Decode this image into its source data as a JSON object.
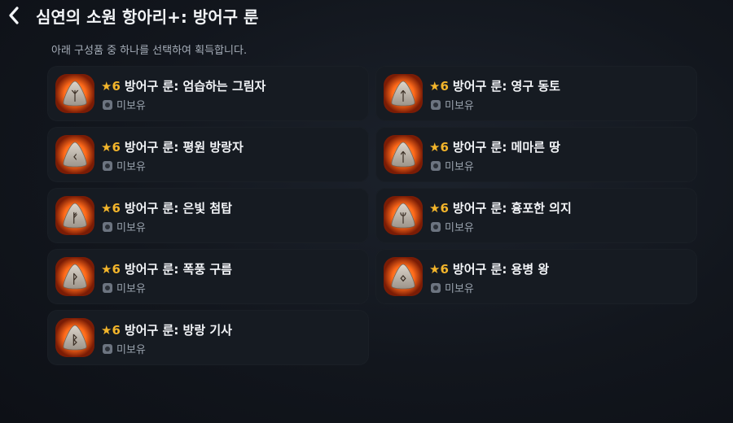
{
  "header": {
    "title": "심연의 소원 항아리+: 방어구 룬",
    "subtitle": "아래 구성품 중 하나를 선택하여 획득합니다."
  },
  "colors": {
    "accent_star": "#f3b52b",
    "rune_glow": "#ff6a1a"
  },
  "items": [
    {
      "star": "★",
      "grade": "6",
      "name": "방어구 룬: 엄습하는 그림자",
      "status": "미보유",
      "glyph": "ᛉ"
    },
    {
      "star": "★",
      "grade": "6",
      "name": "방어구 룬: 영구 동토",
      "status": "미보유",
      "glyph": "ᛏ"
    },
    {
      "star": "★",
      "grade": "6",
      "name": "방어구 룬: 평원 방랑자",
      "status": "미보유",
      "glyph": "ᚲ"
    },
    {
      "star": "★",
      "grade": "6",
      "name": "방어구 룬: 메마른 땅",
      "status": "미보유",
      "glyph": "ᛏ"
    },
    {
      "star": "★",
      "grade": "6",
      "name": "방어구 룬: 은빛 첨탑",
      "status": "미보유",
      "glyph": "ᚠ"
    },
    {
      "star": "★",
      "grade": "6",
      "name": "방어구 룬: 흉포한 의지",
      "status": "미보유",
      "glyph": "ᛘ"
    },
    {
      "star": "★",
      "grade": "6",
      "name": "방어구 룬: 폭풍 구름",
      "status": "미보유",
      "glyph": "ᚹ"
    },
    {
      "star": "★",
      "grade": "6",
      "name": "방어구 룬: 용병 왕",
      "status": "미보유",
      "glyph": "ᛜ"
    },
    {
      "star": "★",
      "grade": "6",
      "name": "방어구 룬: 방랑 기사",
      "status": "미보유",
      "glyph": "ᛒ"
    }
  ]
}
